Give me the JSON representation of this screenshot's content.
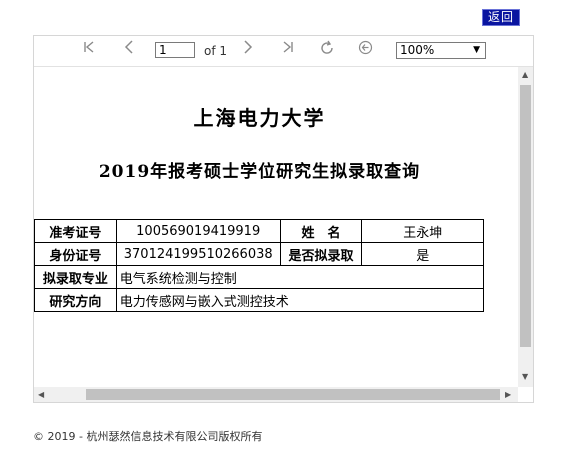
{
  "header": {
    "back_label": "返回"
  },
  "toolbar": {
    "first_page_icon": "first-page-icon",
    "prev_icon": "chevron-left-icon",
    "page_value": "1",
    "of_label": "of 1",
    "next_icon": "chevron-right-icon",
    "last_page_icon": "last-page-icon",
    "refresh_icon": "refresh-icon",
    "back_icon": "back-circle-icon",
    "zoom_value": "100%"
  },
  "document": {
    "title": "上海电力大学",
    "subtitle": "2019年报考硕士学位研究生拟录取查询",
    "rows": [
      {
        "label_a": "准考证号",
        "value_a": "100569019419919",
        "label_b": "姓　名",
        "value_b": "王永坤"
      },
      {
        "label_a": "身份证号",
        "value_a": "370124199510266038",
        "label_b": "是否拟录取",
        "value_b": "是"
      },
      {
        "label_a": "拟录取专业",
        "value_a": "电气系统检测与控制"
      },
      {
        "label_a": "研究方向",
        "value_a": "电力传感网与嵌入式测控技术"
      }
    ]
  },
  "footer": {
    "copyright": "© 2019 - 杭州瑟然信息技术有限公司版权所有"
  }
}
